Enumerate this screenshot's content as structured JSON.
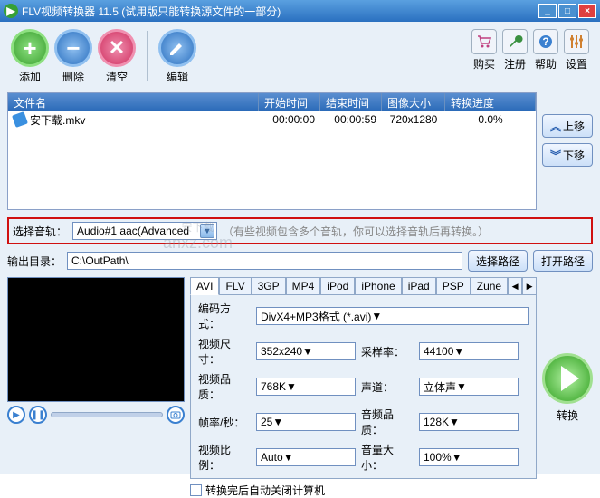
{
  "window": {
    "title": "FLV视频转换器 11.5 (试用版只能转换源文件的一部分)"
  },
  "toolbar": {
    "add": "添加",
    "delete": "删除",
    "clear": "清空",
    "edit": "编辑"
  },
  "rightTools": {
    "buy": "购买",
    "register": "注册",
    "help": "帮助",
    "settings": "设置"
  },
  "filelist": {
    "headers": {
      "name": "文件名",
      "start": "开始时间",
      "end": "结束时间",
      "size": "图像大小",
      "progress": "转换进度"
    },
    "rows": [
      {
        "name": "安下载.mkv",
        "start": "00:00:00",
        "end": "00:00:59",
        "size": "720x1280",
        "progress": "0.0%"
      }
    ]
  },
  "sideBtns": {
    "up": "上移",
    "down": "下移"
  },
  "audioRow": {
    "label": "选择音轨：",
    "value": "Audio#1 aac(Advanced",
    "hint": "（有些视频包含多个音轨，你可以选择音轨后再转换。）"
  },
  "output": {
    "label": "输出目录：",
    "path": "C:\\OutPath\\",
    "choose": "选择路径",
    "open": "打开路径"
  },
  "tabs": [
    "AVI",
    "FLV",
    "3GP",
    "MP4",
    "iPod",
    "iPhone",
    "iPad",
    "PSP",
    "Zune"
  ],
  "form": {
    "encodeLabel": "编码方式：",
    "encodeVal": "DivX4+MP3格式 (*.avi)",
    "videoSizeLabel": "视频尺寸：",
    "videoSizeVal": "352x240",
    "sampleLabel": "采样率：",
    "sampleVal": "44100",
    "videoQLabel": "视频品质：",
    "videoQVal": "768K",
    "channelLabel": "声道：",
    "channelVal": "立体声",
    "fpsLabel": "帧率/秒：",
    "fpsVal": "25",
    "audioQLabel": "音频品质：",
    "audioQVal": "128K",
    "ratioLabel": "视频比例：",
    "ratioVal": "Auto",
    "volumeLabel": "音量大小：",
    "volumeVal": "100%",
    "shutdown": "转换完后自动关闭计算机"
  },
  "convert": "转换",
  "watermark": {
    "l1": "安下载",
    "l2": "anxz.com"
  }
}
